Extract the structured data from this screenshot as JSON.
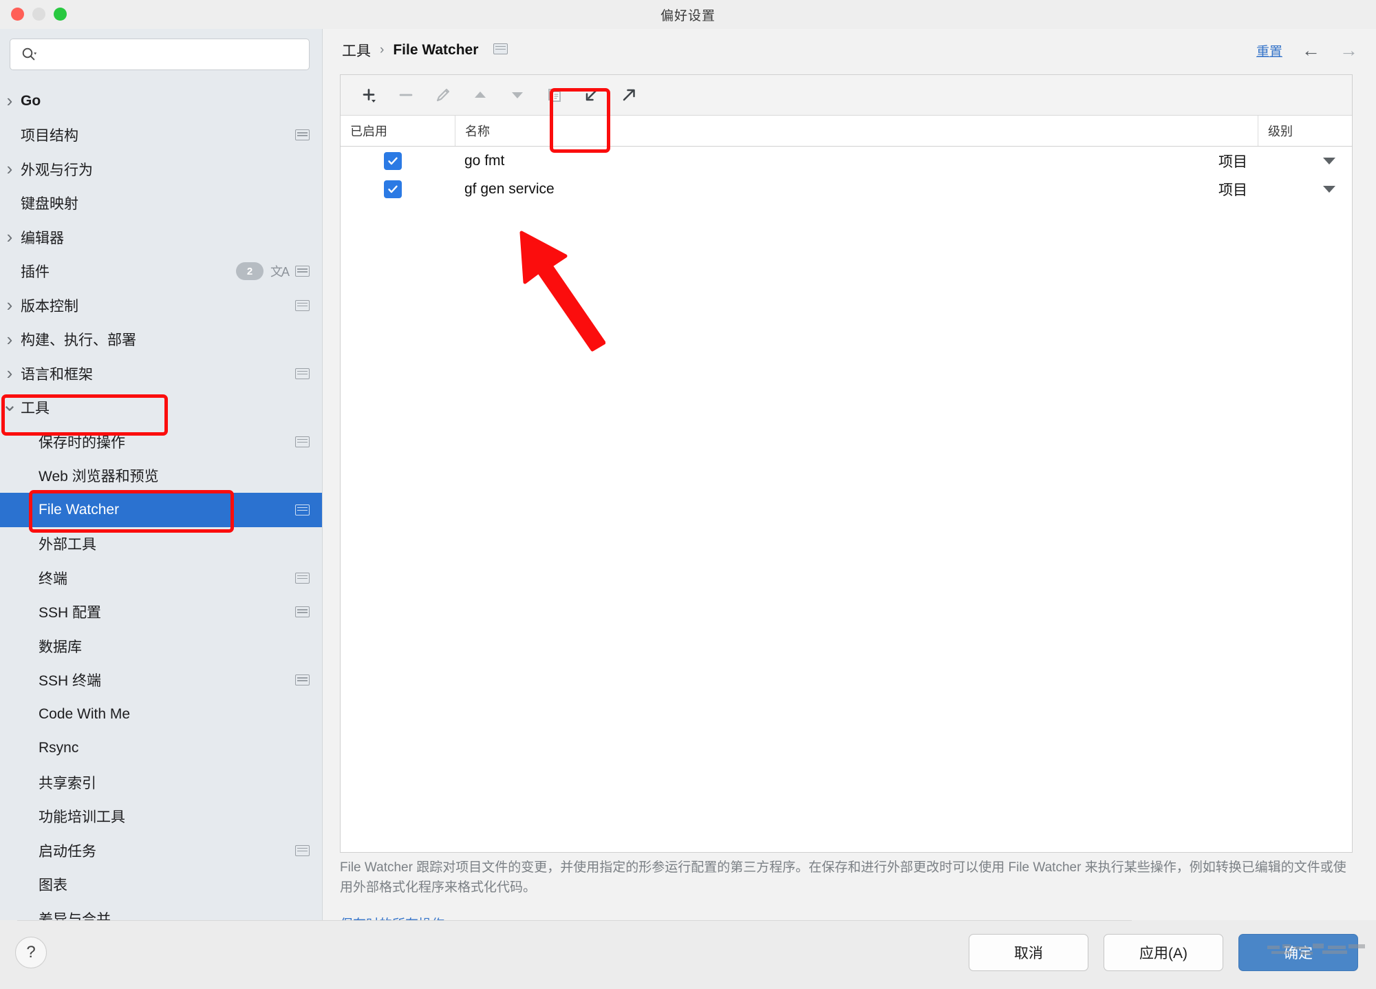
{
  "window": {
    "title": "偏好设置",
    "traffic_lights": [
      "close",
      "minimize",
      "maximize"
    ]
  },
  "sidebar": {
    "search": {
      "value": "",
      "placeholder": "",
      "icon": "search-icon"
    },
    "items": [
      {
        "label": "Go",
        "level": 0,
        "chevron": "right",
        "bold": true,
        "badge": "",
        "mini": false,
        "lang": false
      },
      {
        "label": "项目结构",
        "level": 0,
        "chevron": "",
        "bold": false,
        "badge": "",
        "mini": true,
        "lang": false
      },
      {
        "label": "外观与行为",
        "level": 0,
        "chevron": "right",
        "bold": false,
        "badge": "",
        "mini": false,
        "lang": false
      },
      {
        "label": "键盘映射",
        "level": 0,
        "chevron": "",
        "bold": false,
        "badge": "",
        "mini": false,
        "lang": false
      },
      {
        "label": "编辑器",
        "level": 0,
        "chevron": "right",
        "bold": false,
        "badge": "",
        "mini": false,
        "lang": false
      },
      {
        "label": "插件",
        "level": 0,
        "chevron": "",
        "bold": false,
        "badge": "2",
        "mini": true,
        "lang": true
      },
      {
        "label": "版本控制",
        "level": 0,
        "chevron": "right",
        "bold": false,
        "badge": "",
        "mini": true,
        "lang": false
      },
      {
        "label": "构建、执行、部署",
        "level": 0,
        "chevron": "right",
        "bold": false,
        "badge": "",
        "mini": false,
        "lang": false
      },
      {
        "label": "语言和框架",
        "level": 0,
        "chevron": "right",
        "bold": false,
        "badge": "",
        "mini": true,
        "lang": false
      },
      {
        "label": "工具",
        "level": 0,
        "chevron": "down",
        "bold": false,
        "badge": "",
        "mini": false,
        "lang": false
      },
      {
        "label": "保存时的操作",
        "level": 1,
        "chevron": "",
        "bold": false,
        "badge": "",
        "mini": true,
        "lang": false
      },
      {
        "label": "Web 浏览器和预览",
        "level": 1,
        "chevron": "",
        "bold": false,
        "badge": "",
        "mini": false,
        "lang": false
      },
      {
        "label": "File Watcher",
        "level": 1,
        "chevron": "",
        "bold": false,
        "badge": "",
        "mini": true,
        "lang": false,
        "selected": true
      },
      {
        "label": "外部工具",
        "level": 1,
        "chevron": "",
        "bold": false,
        "badge": "",
        "mini": false,
        "lang": false
      },
      {
        "label": "终端",
        "level": 1,
        "chevron": "",
        "bold": false,
        "badge": "",
        "mini": true,
        "lang": false
      },
      {
        "label": "SSH 配置",
        "level": 1,
        "chevron": "",
        "bold": false,
        "badge": "",
        "mini": true,
        "lang": false
      },
      {
        "label": "数据库",
        "level": 1,
        "chevron": "right",
        "bold": false,
        "badge": "",
        "mini": false,
        "lang": false
      },
      {
        "label": "SSH 终端",
        "level": 1,
        "chevron": "",
        "bold": false,
        "badge": "",
        "mini": true,
        "lang": false
      },
      {
        "label": "Code With Me",
        "level": 1,
        "chevron": "",
        "bold": false,
        "badge": "",
        "mini": false,
        "lang": false
      },
      {
        "label": "Rsync",
        "level": 1,
        "chevron": "",
        "bold": false,
        "badge": "",
        "mini": false,
        "lang": false
      },
      {
        "label": "共享索引",
        "level": 1,
        "chevron": "",
        "bold": false,
        "badge": "",
        "mini": false,
        "lang": false
      },
      {
        "label": "功能培训工具",
        "level": 1,
        "chevron": "",
        "bold": false,
        "badge": "",
        "mini": false,
        "lang": false
      },
      {
        "label": "启动任务",
        "level": 1,
        "chevron": "",
        "bold": false,
        "badge": "",
        "mini": true,
        "lang": false
      },
      {
        "label": "图表",
        "level": 1,
        "chevron": "",
        "bold": false,
        "badge": "",
        "mini": false,
        "lang": false
      },
      {
        "label": "差异与合并",
        "level": 1,
        "chevron": "right",
        "bold": false,
        "badge": "",
        "mini": false,
        "lang": false
      }
    ]
  },
  "header": {
    "breadcrumb_parent": "工具",
    "breadcrumb_separator": "›",
    "breadcrumb_current": "File Watcher",
    "reset_label": "重置",
    "back_arrow": "←",
    "forward_arrow": "→"
  },
  "toolbar": {
    "buttons": [
      {
        "name": "add-button",
        "icon": "plus-icon",
        "enabled": true
      },
      {
        "name": "remove-button",
        "icon": "minus-icon",
        "enabled": false
      },
      {
        "name": "edit-button",
        "icon": "pencil-icon",
        "enabled": false
      },
      {
        "name": "move-up-button",
        "icon": "arrow-up-icon",
        "enabled": false
      },
      {
        "name": "move-down-button",
        "icon": "arrow-down-icon",
        "enabled": false
      },
      {
        "name": "copy-button",
        "icon": "copy-icon",
        "enabled": false
      },
      {
        "name": "import-button",
        "icon": "import-icon",
        "enabled": true
      },
      {
        "name": "export-button",
        "icon": "export-icon",
        "enabled": true
      }
    ]
  },
  "table": {
    "columns": [
      "已启用",
      "名称",
      "级别"
    ],
    "rows": [
      {
        "enabled": true,
        "name": "go fmt",
        "level": "项目"
      },
      {
        "enabled": true,
        "name": "gf gen service",
        "level": "项目"
      }
    ]
  },
  "description": {
    "text": "File Watcher 跟踪对项目文件的变更，并使用指定的形参运行配置的第三方程序。在保存和进行外部更改时可以使用 File Watcher 来执行某些操作，例如转换已编辑的文件或使用外部格式化程序来格式化代码。",
    "link": "保存时的所有操作..."
  },
  "footer": {
    "help_label": "?",
    "cancel_label": "取消",
    "apply_label": "应用(A)",
    "ok_label": "确定"
  },
  "colors": {
    "accent": "#2b72d0",
    "link": "#3574c9",
    "annotation": "#fb0d0d",
    "checkbox": "#2b7ae4",
    "primary_button": "#4a86c8"
  }
}
